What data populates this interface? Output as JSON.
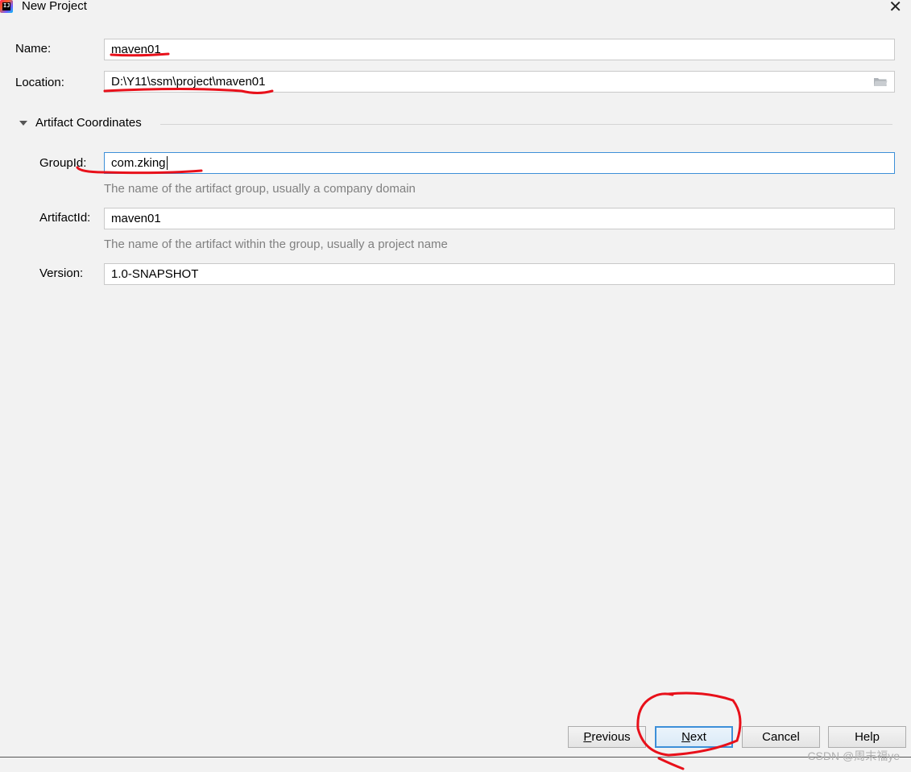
{
  "window": {
    "title": "New Project",
    "close_glyph": "✕",
    "app_icon": "intellij-idea-icon"
  },
  "form": {
    "name": {
      "label": "Name:",
      "value": "maven01"
    },
    "location": {
      "label": "Location:",
      "value": "D:\\Y11\\ssm\\project\\maven01"
    }
  },
  "artifact": {
    "section_title": "Artifact Coordinates",
    "group_id": {
      "label": "GroupId:",
      "value": "com.zking",
      "hint": "The name of the artifact group, usually a company domain"
    },
    "artifact_id": {
      "label": "ArtifactId:",
      "value": "maven01",
      "hint": "The name of the artifact within the group, usually a project name"
    },
    "version": {
      "label": "Version:",
      "value": "1.0-SNAPSHOT"
    }
  },
  "buttons": {
    "previous": {
      "mnemonic": "P",
      "rest": "revious"
    },
    "next": {
      "mnemonic": "N",
      "rest": "ext"
    },
    "cancel": "Cancel",
    "help": "Help"
  },
  "watermark": "CSDN @周末福ye",
  "annotation_color": "#e8101a"
}
